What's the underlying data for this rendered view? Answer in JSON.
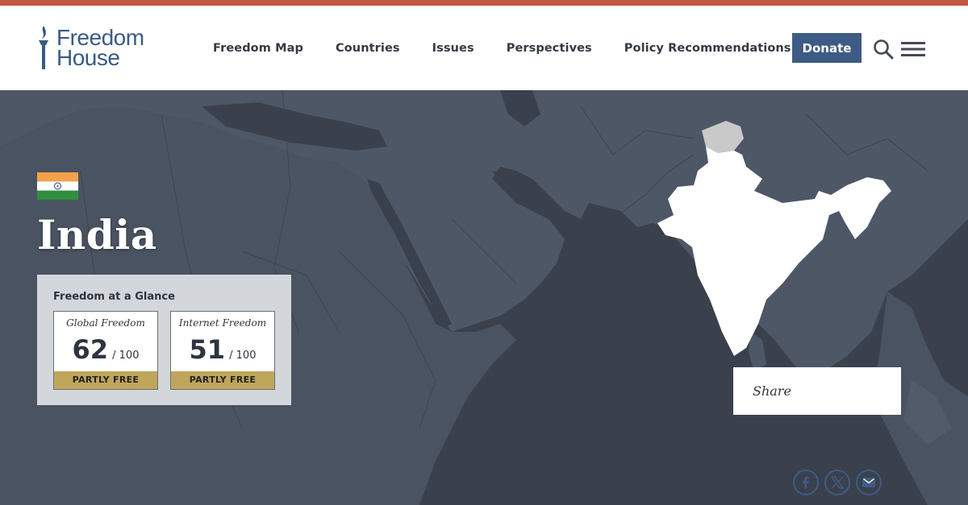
{
  "brand": {
    "logo_line1": "Freedom",
    "logo_line2": "House",
    "accent_color": "#3e5b85",
    "stripe_color": "#c0573f"
  },
  "nav": {
    "items": [
      {
        "label": "Freedom Map"
      },
      {
        "label": "Countries"
      },
      {
        "label": "Issues"
      },
      {
        "label": "Perspectives"
      },
      {
        "label": "Policy Recommendations"
      }
    ],
    "donate_label": "Donate"
  },
  "hero": {
    "country": "India",
    "glance_title": "Freedom at a Glance",
    "cards": [
      {
        "label": "Global Freedom",
        "score": "62",
        "max": "/ 100",
        "status": "PARTLY FREE"
      },
      {
        "label": "Internet Freedom",
        "score": "51",
        "max": "/ 100",
        "status": "PARTLY FREE"
      }
    ],
    "status_color": "#bfa65a"
  },
  "share": {
    "label": "Share"
  }
}
